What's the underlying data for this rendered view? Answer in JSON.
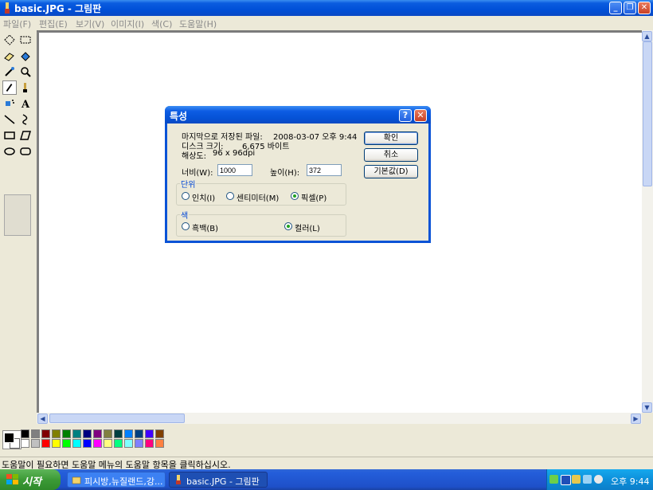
{
  "window": {
    "title": "basic.JPG - 그림판",
    "controls": {
      "minimize": "_",
      "maximize": "❐",
      "close": "✕"
    }
  },
  "menu": [
    "파일(F)",
    "편집(E)",
    "보기(V)",
    "이미지(I)",
    "색(C)",
    "도움말(H)"
  ],
  "toolbox": {
    "tools": [
      "free-select",
      "rect-select",
      "eraser",
      "fill",
      "color-picker",
      "magnifier",
      "pencil",
      "brush",
      "airbrush",
      "text",
      "line",
      "curve",
      "rectangle",
      "polygon",
      "ellipse",
      "rounded-rect"
    ],
    "selected": "pencil"
  },
  "dialog": {
    "title": "특성",
    "help": "?",
    "close": "✕",
    "last_saved_label": "마지막으로 저장된 파일:",
    "last_saved_value": "2008-03-07 오후 9:44",
    "disk_size_label": "디스크 크기:",
    "disk_size_value": "6,675 바이트",
    "resolution_label": "해상도:",
    "resolution_value": "96 x 96dpi",
    "width_label": "너비(W):",
    "width_value": "1000",
    "height_label": "높이(H):",
    "height_value": "372",
    "units_group": "단위",
    "units": [
      {
        "label": "인치(I)",
        "selected": false
      },
      {
        "label": "센티미터(M)",
        "selected": false
      },
      {
        "label": "픽셀(P)",
        "selected": true
      }
    ],
    "color_group": "색",
    "colors": [
      {
        "label": "흑백(B)",
        "selected": false
      },
      {
        "label": "컬러(L)",
        "selected": true
      }
    ],
    "ok": "확인",
    "cancel": "취소",
    "default": "기본값(D)"
  },
  "palette": {
    "foreground": "#000000",
    "background": "#ffffff",
    "top_row": [
      "#000000",
      "#808080",
      "#800000",
      "#808000",
      "#008000",
      "#008080",
      "#000080",
      "#800080",
      "#808040",
      "#004040",
      "#0080ff",
      "#004080",
      "#4000ff",
      "#804000"
    ],
    "bottom_row": [
      "#ffffff",
      "#c0c0c0",
      "#ff0000",
      "#ffff00",
      "#00ff00",
      "#00ffff",
      "#0000ff",
      "#ff00ff",
      "#ffff80",
      "#00ff80",
      "#80ffff",
      "#8080ff",
      "#ff0080",
      "#ff8040"
    ]
  },
  "status": "도움말이 필요하면 도움말 메뉴의 도움말 항목을 클릭하십시오.",
  "taskbar": {
    "start": "시작",
    "tasks": [
      "피시방,뉴질랜드,강...",
      "basic.JPG - 그림판"
    ],
    "clock": "오후 9:44"
  }
}
